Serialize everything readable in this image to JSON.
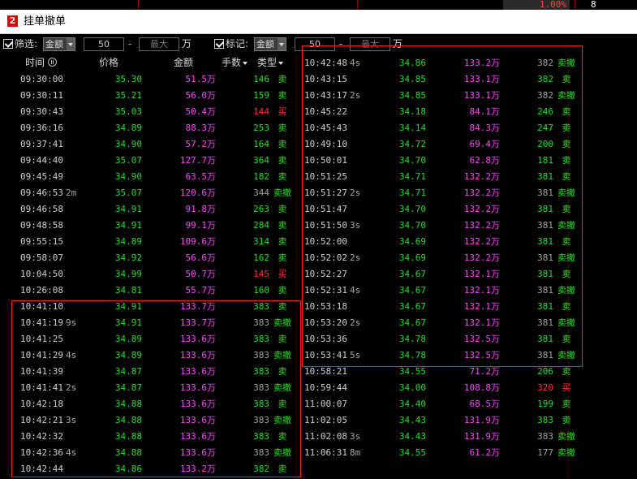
{
  "top": {
    "percent": "1.00%",
    "right_value": "8"
  },
  "window": {
    "badge": "2",
    "title": "挂单撤单"
  },
  "filter": {
    "screen_label": "筛选:",
    "screen_field": "金额",
    "screen_min": "50",
    "screen_max_placeholder": "最大",
    "screen_unit": "万",
    "mark_label": "标记:",
    "mark_field": "金额",
    "mark_min": "50",
    "mark_max_placeholder": "最大",
    "mark_unit": "万",
    "dash": "-"
  },
  "headers": {
    "time": "时间",
    "price": "价格",
    "amount": "金额",
    "volume": "手数",
    "type": "类型"
  },
  "left_rows": [
    {
      "time": "09:30:00",
      "dur": "",
      "price": "35.30",
      "amount": "51.5万",
      "vol": "146",
      "vc": "green",
      "type": "卖",
      "tc": "green"
    },
    {
      "time": "09:30:11",
      "dur": "",
      "price": "35.21",
      "amount": "56.0万",
      "vol": "159",
      "vc": "green",
      "type": "卖",
      "tc": "green"
    },
    {
      "time": "09:30:43",
      "dur": "",
      "price": "35.03",
      "amount": "50.4万",
      "vol": "144",
      "vc": "red",
      "type": "买",
      "tc": "red"
    },
    {
      "time": "09:36:16",
      "dur": "",
      "price": "34.89",
      "amount": "88.3万",
      "vol": "253",
      "vc": "green",
      "type": "卖",
      "tc": "green"
    },
    {
      "time": "09:37:41",
      "dur": "",
      "price": "34.90",
      "amount": "57.2万",
      "vol": "164",
      "vc": "green",
      "type": "卖",
      "tc": "green"
    },
    {
      "time": "09:44:40",
      "dur": "",
      "price": "35.07",
      "amount": "127.7万",
      "vol": "364",
      "vc": "green",
      "type": "卖",
      "tc": "green"
    },
    {
      "time": "09:45:49",
      "dur": "",
      "price": "34.90",
      "amount": "63.5万",
      "vol": "182",
      "vc": "green",
      "type": "卖",
      "tc": "green"
    },
    {
      "time": "09:46:53",
      "dur": "2m",
      "price": "35.07",
      "amount": "120.6万",
      "vol": "344",
      "vc": "gray",
      "type": "卖撤",
      "tc": "green"
    },
    {
      "time": "09:46:58",
      "dur": "",
      "price": "34.91",
      "amount": "91.8万",
      "vol": "263",
      "vc": "green",
      "type": "卖",
      "tc": "green"
    },
    {
      "time": "09:48:58",
      "dur": "",
      "price": "34.91",
      "amount": "99.1万",
      "vol": "284",
      "vc": "green",
      "type": "卖",
      "tc": "green"
    },
    {
      "time": "09:55:15",
      "dur": "",
      "price": "34.89",
      "amount": "109.6万",
      "vol": "314",
      "vc": "green",
      "type": "卖",
      "tc": "green"
    },
    {
      "time": "09:58:07",
      "dur": "",
      "price": "34.92",
      "amount": "56.6万",
      "vol": "162",
      "vc": "green",
      "type": "卖",
      "tc": "green"
    },
    {
      "time": "10:04:50",
      "dur": "",
      "price": "34.99",
      "amount": "50.7万",
      "vol": "145",
      "vc": "red",
      "type": "买",
      "tc": "red"
    },
    {
      "time": "10:26:08",
      "dur": "",
      "price": "34.81",
      "amount": "55.7万",
      "vol": "160",
      "vc": "green",
      "type": "卖",
      "tc": "green"
    },
    {
      "time": "10:41:10",
      "dur": "",
      "price": "34.91",
      "amount": "133.7万",
      "vol": "383",
      "vc": "green",
      "type": "卖",
      "tc": "green"
    },
    {
      "time": "10:41:19",
      "dur": "9s",
      "price": "34.91",
      "amount": "133.7万",
      "vol": "383",
      "vc": "gray",
      "type": "卖撤",
      "tc": "green"
    },
    {
      "time": "10:41:25",
      "dur": "",
      "price": "34.89",
      "amount": "133.6万",
      "vol": "383",
      "vc": "green",
      "type": "卖",
      "tc": "green"
    },
    {
      "time": "10:41:29",
      "dur": "4s",
      "price": "34.89",
      "amount": "133.6万",
      "vol": "383",
      "vc": "gray",
      "type": "卖撤",
      "tc": "green"
    },
    {
      "time": "10:41:39",
      "dur": "",
      "price": "34.87",
      "amount": "133.6万",
      "vol": "383",
      "vc": "green",
      "type": "卖",
      "tc": "green"
    },
    {
      "time": "10:41:41",
      "dur": "2s",
      "price": "34.87",
      "amount": "133.6万",
      "vol": "383",
      "vc": "gray",
      "type": "卖撤",
      "tc": "green"
    },
    {
      "time": "10:42:18",
      "dur": "",
      "price": "34.88",
      "amount": "133.6万",
      "vol": "383",
      "vc": "green",
      "type": "卖",
      "tc": "green"
    },
    {
      "time": "10:42:21",
      "dur": "3s",
      "price": "34.88",
      "amount": "133.6万",
      "vol": "383",
      "vc": "gray",
      "type": "卖撤",
      "tc": "green"
    },
    {
      "time": "10:42:32",
      "dur": "",
      "price": "34.88",
      "amount": "133.6万",
      "vol": "383",
      "vc": "green",
      "type": "卖",
      "tc": "green"
    },
    {
      "time": "10:42:36",
      "dur": "4s",
      "price": "34.88",
      "amount": "133.6万",
      "vol": "383",
      "vc": "gray",
      "type": "卖撤",
      "tc": "green"
    },
    {
      "time": "10:42:44",
      "dur": "",
      "price": "34.86",
      "amount": "133.2万",
      "vol": "382",
      "vc": "green",
      "type": "卖",
      "tc": "green"
    }
  ],
  "right_rows": [
    {
      "time": "10:42:48",
      "dur": "4s",
      "price": "34.86",
      "amount": "133.2万",
      "vol": "382",
      "vc": "gray",
      "type": "卖撤",
      "tc": "green"
    },
    {
      "time": "10:43:15",
      "dur": "",
      "price": "34.85",
      "amount": "133.1万",
      "vol": "382",
      "vc": "green",
      "type": "卖",
      "tc": "green"
    },
    {
      "time": "10:43:17",
      "dur": "2s",
      "price": "34.85",
      "amount": "133.1万",
      "vol": "382",
      "vc": "gray",
      "type": "卖撤",
      "tc": "green"
    },
    {
      "time": "10:45:22",
      "dur": "",
      "price": "34.18",
      "amount": "84.1万",
      "vol": "246",
      "vc": "green",
      "type": "卖",
      "tc": "green"
    },
    {
      "time": "10:45:43",
      "dur": "",
      "price": "34.14",
      "amount": "84.3万",
      "vol": "247",
      "vc": "green",
      "type": "卖",
      "tc": "green"
    },
    {
      "time": "10:49:10",
      "dur": "",
      "price": "34.72",
      "amount": "69.4万",
      "vol": "200",
      "vc": "green",
      "type": "卖",
      "tc": "green"
    },
    {
      "time": "10:50:01",
      "dur": "",
      "price": "34.70",
      "amount": "62.8万",
      "vol": "181",
      "vc": "green",
      "type": "卖",
      "tc": "green"
    },
    {
      "time": "10:51:25",
      "dur": "",
      "price": "34.71",
      "amount": "132.2万",
      "vol": "381",
      "vc": "green",
      "type": "卖",
      "tc": "green"
    },
    {
      "time": "10:51:27",
      "dur": "2s",
      "price": "34.71",
      "amount": "132.2万",
      "vol": "381",
      "vc": "gray",
      "type": "卖撤",
      "tc": "green"
    },
    {
      "time": "10:51:47",
      "dur": "",
      "price": "34.70",
      "amount": "132.2万",
      "vol": "381",
      "vc": "green",
      "type": "卖",
      "tc": "green"
    },
    {
      "time": "10:51:50",
      "dur": "3s",
      "price": "34.70",
      "amount": "132.2万",
      "vol": "381",
      "vc": "gray",
      "type": "卖撤",
      "tc": "green"
    },
    {
      "time": "10:52:00",
      "dur": "",
      "price": "34.69",
      "amount": "132.2万",
      "vol": "381",
      "vc": "green",
      "type": "卖",
      "tc": "green"
    },
    {
      "time": "10:52:02",
      "dur": "2s",
      "price": "34.69",
      "amount": "132.2万",
      "vol": "381",
      "vc": "gray",
      "type": "卖撤",
      "tc": "green"
    },
    {
      "time": "10:52:27",
      "dur": "",
      "price": "34.67",
      "amount": "132.1万",
      "vol": "381",
      "vc": "green",
      "type": "卖",
      "tc": "green"
    },
    {
      "time": "10:52:31",
      "dur": "4s",
      "price": "34.67",
      "amount": "132.1万",
      "vol": "381",
      "vc": "gray",
      "type": "卖撤",
      "tc": "green"
    },
    {
      "time": "10:53:18",
      "dur": "",
      "price": "34.67",
      "amount": "132.1万",
      "vol": "381",
      "vc": "green",
      "type": "卖",
      "tc": "green"
    },
    {
      "time": "10:53:20",
      "dur": "2s",
      "price": "34.67",
      "amount": "132.1万",
      "vol": "381",
      "vc": "gray",
      "type": "卖撤",
      "tc": "green"
    },
    {
      "time": "10:53:36",
      "dur": "",
      "price": "34.78",
      "amount": "132.5万",
      "vol": "381",
      "vc": "green",
      "type": "卖",
      "tc": "green"
    },
    {
      "time": "10:53:41",
      "dur": "5s",
      "price": "34.78",
      "amount": "132.5万",
      "vol": "381",
      "vc": "gray",
      "type": "卖撤",
      "tc": "green"
    },
    {
      "time": "10:58:21",
      "dur": "",
      "price": "34.55",
      "amount": "71.2万",
      "vol": "206",
      "vc": "green",
      "type": "卖",
      "tc": "green"
    },
    {
      "time": "10:59:44",
      "dur": "",
      "price": "34.00",
      "amount": "108.8万",
      "vol": "320",
      "vc": "red",
      "type": "买",
      "tc": "red"
    },
    {
      "time": "11:00:07",
      "dur": "",
      "price": "34.40",
      "amount": "68.5万",
      "vol": "199",
      "vc": "green",
      "type": "卖",
      "tc": "green"
    },
    {
      "time": "11:02:05",
      "dur": "",
      "price": "34.43",
      "amount": "131.9万",
      "vol": "383",
      "vc": "green",
      "type": "卖",
      "tc": "green"
    },
    {
      "time": "11:02:08",
      "dur": "3s",
      "price": "34.43",
      "amount": "131.9万",
      "vol": "383",
      "vc": "gray",
      "type": "卖撤",
      "tc": "green"
    },
    {
      "time": "11:06:31",
      "dur": "8m",
      "price": "34.55",
      "amount": "61.2万",
      "vol": "177",
      "vc": "gray",
      "type": "卖撤",
      "tc": "green"
    }
  ],
  "colors": {
    "price": "#22dd22",
    "amount": "#ff40ff",
    "sell": "#22dd22",
    "buy": "#ff3030",
    "highlight_box": "#ff2020"
  }
}
